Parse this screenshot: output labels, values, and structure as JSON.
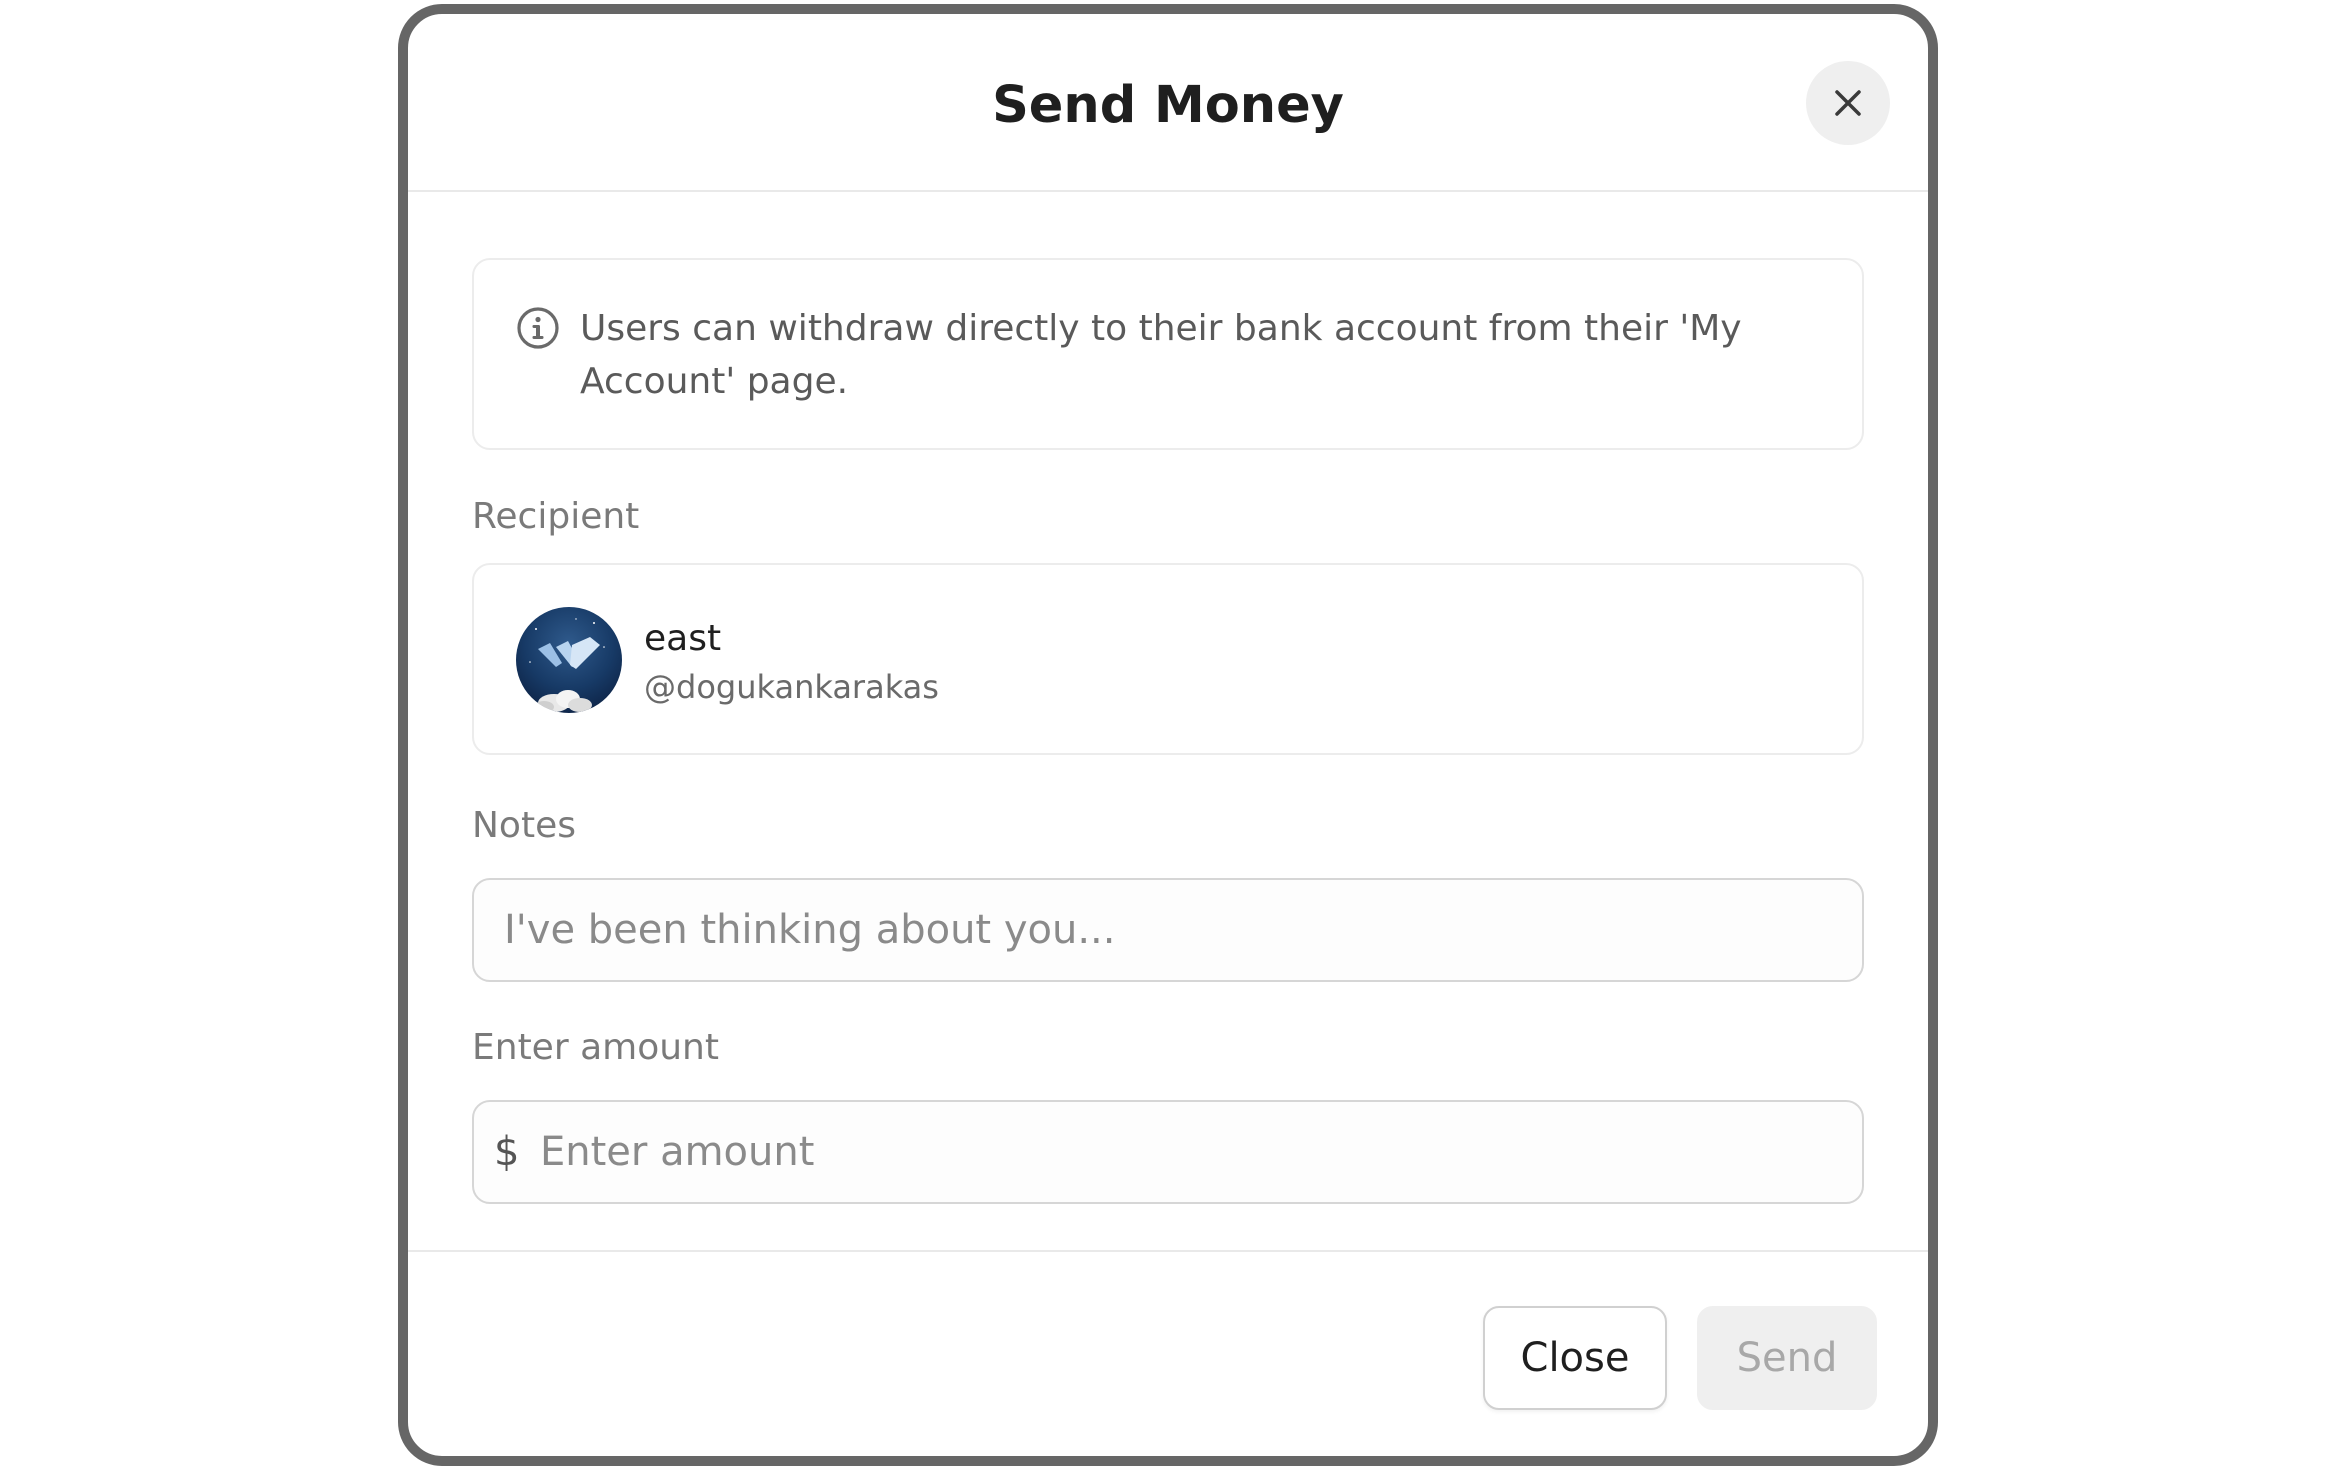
{
  "dialog": {
    "title": "Send Money",
    "close_icon": "close-icon"
  },
  "info": {
    "icon": "info-icon",
    "text": "Users can withdraw directly to their bank account from their 'My Account' page."
  },
  "recipient": {
    "label": "Recipient",
    "name": "east",
    "handle": "@dogukankarakas",
    "avatar_icon": "avatar-image"
  },
  "notes": {
    "label": "Notes",
    "value": "",
    "placeholder": "I've been thinking about you..."
  },
  "amount": {
    "label": "Enter amount",
    "currency_symbol": "$",
    "value": "",
    "placeholder": "Enter amount"
  },
  "footer": {
    "close_label": "Close",
    "send_label": "Send",
    "send_disabled": true
  },
  "colors": {
    "border": "#666666",
    "title_text": "#1f1f1f",
    "muted_text": "#7a7a7a",
    "disabled_button_bg": "#efefef",
    "disabled_button_text": "#a8a8a8"
  }
}
